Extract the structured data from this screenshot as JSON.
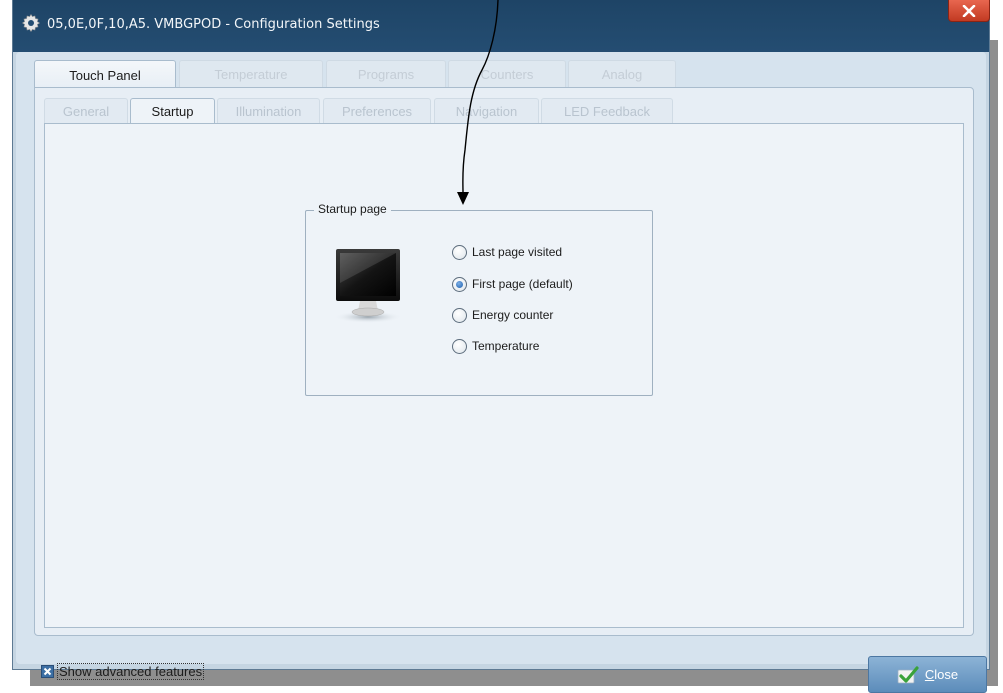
{
  "window": {
    "title": "05,0E,0F,10,A5. VMBGPOD - Configuration Settings",
    "icon": "gear-icon",
    "close_icon": "close-x-icon"
  },
  "main_tabs": [
    {
      "label": "Touch Panel",
      "active": true
    },
    {
      "label": "Temperature",
      "active": false
    },
    {
      "label": "Programs",
      "active": false
    },
    {
      "label": "Counters",
      "active": false
    },
    {
      "label": "Analog",
      "active": false
    }
  ],
  "sub_tabs": [
    {
      "label": "General",
      "active": false
    },
    {
      "label": "Startup",
      "active": true
    },
    {
      "label": "Illumination",
      "active": false
    },
    {
      "label": "Preferences",
      "active": false
    },
    {
      "label": "Navigation",
      "active": false
    },
    {
      "label": "LED Feedback",
      "active": false
    }
  ],
  "startup_group": {
    "title": "Startup page",
    "icon": "monitor-icon",
    "options": [
      {
        "label": "Last page visited",
        "checked": false
      },
      {
        "label": "First page (default)",
        "checked": true
      },
      {
        "label": "Energy counter",
        "checked": false
      },
      {
        "label": "Temperature",
        "checked": false
      }
    ]
  },
  "footer": {
    "advanced_label": "Show advanced features",
    "advanced_checked": true,
    "close_first": "C",
    "close_rest": "lose",
    "close_icon": "checkmark-icon"
  },
  "colors": {
    "titlebar": "#1e4466",
    "window_bg": "#c5d5e2",
    "panel_bg": "#eef3f8",
    "close_button": "#6d9bc7",
    "radio_selected": "#1c5fae"
  }
}
